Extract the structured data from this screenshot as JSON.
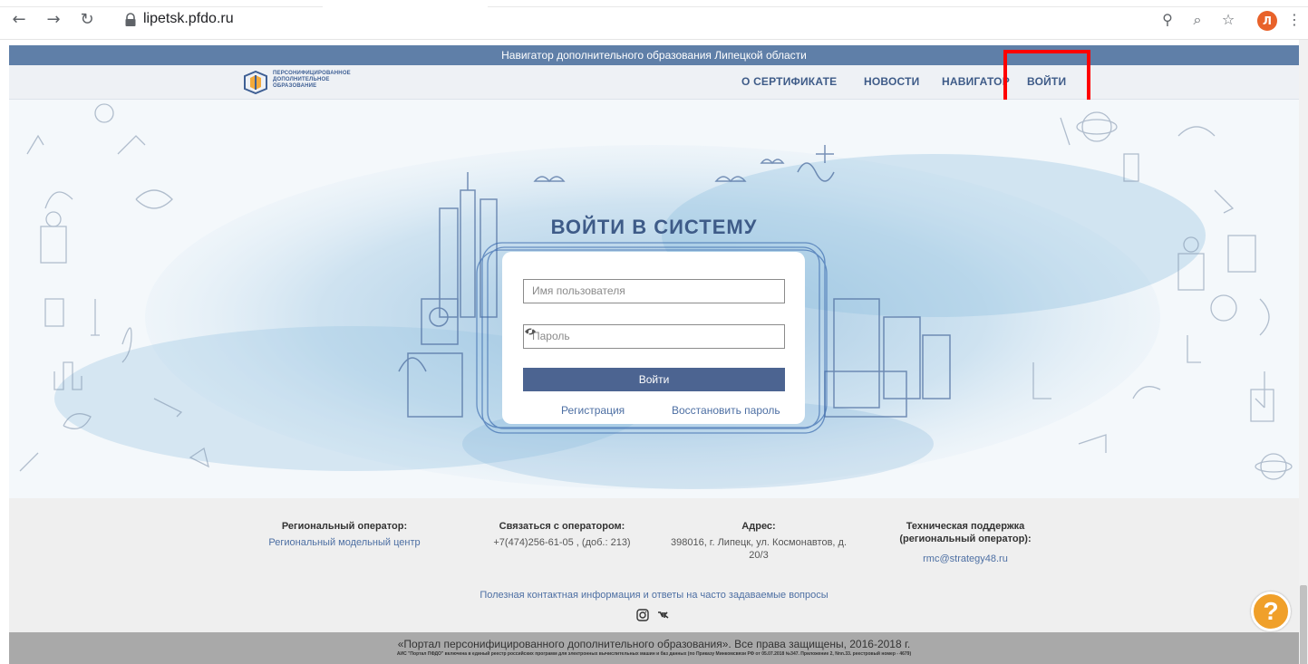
{
  "browser": {
    "url": "lipetsk.pfdo.ru",
    "profile_initial": "Л"
  },
  "site": {
    "top_banner": "Навигатор дополнительного образования Липецкой области",
    "logo_lines": [
      "ПЕРСОНИФИЦИРОВАННОЕ",
      "ДОПОЛНИТЕЛЬНОЕ",
      "ОБРАЗОВАНИЕ"
    ],
    "menu": [
      {
        "label": "О СЕРТИФИКАТЕ"
      },
      {
        "label": "НОВОСТИ"
      },
      {
        "label": "НАВИГАТОР"
      },
      {
        "label": "ВОЙТИ"
      }
    ]
  },
  "login": {
    "title": "ВОЙТИ В СИСТЕМУ",
    "username_placeholder": "Имя пользователя",
    "password_placeholder": "Пароль",
    "submit_label": "Войти",
    "register_link": "Регистрация",
    "restore_link": "Восстановить пароль"
  },
  "footer": {
    "columns": [
      {
        "heading": "Региональный оператор:",
        "value": "Региональный модельный центр"
      },
      {
        "heading": "Связаться с оператором:",
        "value": "+7(474)256-61-05 , (доб.: 213)"
      },
      {
        "heading": "Адрес:",
        "value_line1": "398016, г. Липецк, ул. Космонавтов, д.",
        "value_line2": "20/3"
      },
      {
        "heading_line1": "Техническая поддержка",
        "heading_line2": "(региональный оператор):",
        "value": "rmc@strategy48.ru"
      }
    ],
    "faq_link": "Полезная контактная информация и ответы на часто задаваемые вопросы",
    "copyright": "«Портал персонифицированного дополнительного образования». Все права защищены, 2016-2018 г.",
    "registry_note": "АИС \"Портал ПФДО\" включена в единый реестр российских программ для электронных вычислительных машин и баз данных (по Приказу Минкомсвязи РФ от 05.07.2018 №347. Приложение 2, Nnn.33. реестровый номер - 4679)"
  },
  "help_button_label": "?",
  "colors": {
    "brand_blue": "#3e5b88",
    "top_strip": "#5f7fa8",
    "button": "#4c6491",
    "highlight": "#ff0000",
    "help": "#f0a02a"
  }
}
